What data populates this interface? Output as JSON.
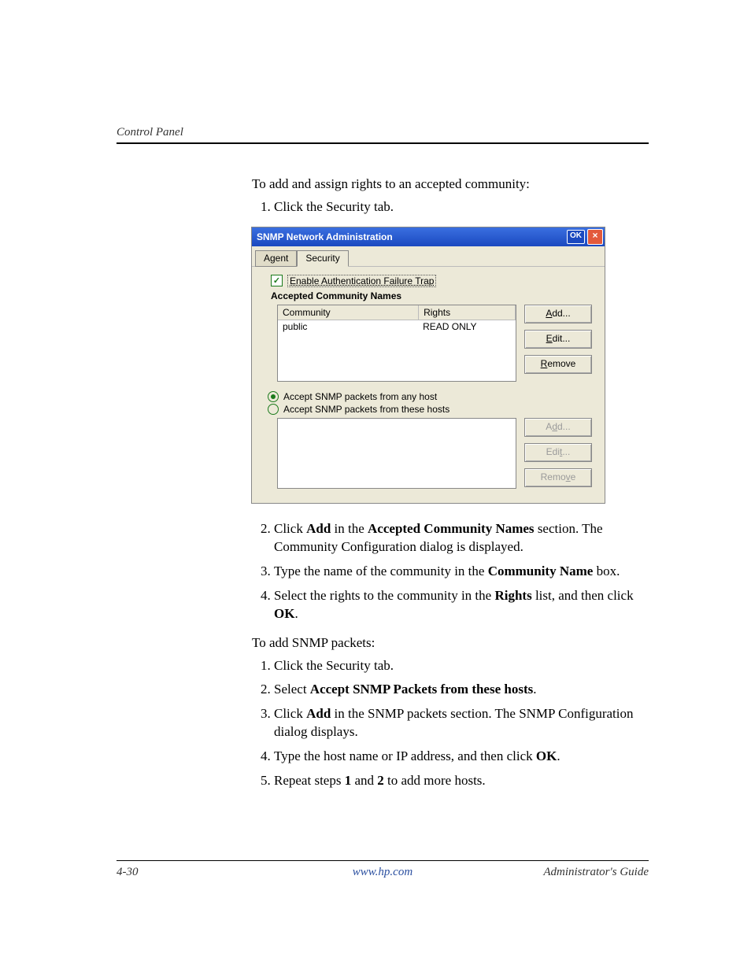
{
  "header": {
    "section": "Control Panel"
  },
  "intro": "To add and assign rights to an accepted community:",
  "steps1": [
    "Click the Security tab."
  ],
  "dialog": {
    "title": "SNMP Network Administration",
    "ok": "OK",
    "close": "×",
    "tabs": {
      "agent": "Agent",
      "security": "Security"
    },
    "checkbox": "Enable Authentication Failure Trap",
    "group1_title": "Accepted Community Names",
    "columns": {
      "c1": "Community",
      "c2": "Rights"
    },
    "rows": [
      {
        "community": "public",
        "rights": "READ ONLY"
      }
    ],
    "buttons": {
      "add": "Add...",
      "edit": "Edit...",
      "remove": "Remove"
    },
    "radios": {
      "any": "Accept SNMP packets from any host",
      "these": "Accept SNMP packets from these hosts"
    },
    "buttons2": {
      "add": "Add...",
      "edit": "Edit...",
      "remove": "Remove"
    }
  },
  "steps2": [
    {
      "pre": "Click ",
      "b1": "Add",
      "mid": " in the ",
      "b2": "Accepted Community Names",
      "post": " section. The Community Configuration dialog is displayed."
    },
    {
      "pre": "Type the name of the community in the ",
      "b1": "Community Name",
      "post": " box."
    },
    {
      "pre": "Select the rights to the community in the ",
      "b1": "Rights",
      "mid": " list, and then click ",
      "b2": "OK",
      "post": "."
    }
  ],
  "intro2": "To add SNMP packets:",
  "steps3": [
    {
      "text": "Click the Security tab."
    },
    {
      "pre": "Select ",
      "b1": "Accept SNMP Packets from these hosts",
      "post": "."
    },
    {
      "pre": "Click ",
      "b1": "Add",
      "post": " in the SNMP packets section. The SNMP Configuration dialog displays."
    },
    {
      "pre": "Type the host name or IP address, and then click ",
      "b1": "OK",
      "post": "."
    },
    {
      "pre": "Repeat steps ",
      "b1": "1",
      "mid": " and ",
      "b2": "2",
      "post": " to add more hosts."
    }
  ],
  "footer": {
    "page": "4-30",
    "url": "www.hp.com",
    "title": "Administrator's Guide"
  }
}
